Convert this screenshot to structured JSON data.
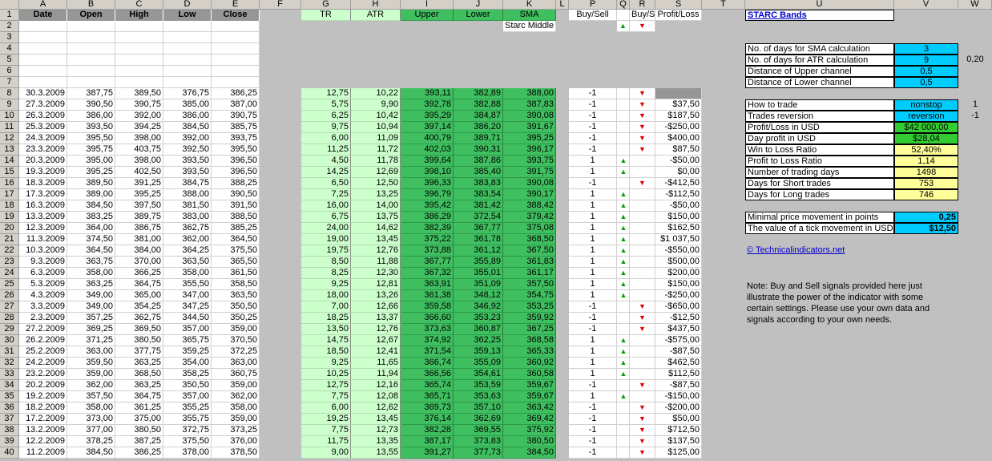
{
  "columns": [
    "A",
    "B",
    "C",
    "D",
    "E",
    "F",
    "G",
    "H",
    "I",
    "J",
    "K",
    "L",
    "P",
    "Q",
    "R",
    "S",
    "T",
    "U",
    "V",
    "W"
  ],
  "headers": {
    "date": "Date",
    "open": "Open",
    "high": "High",
    "low": "Low",
    "close": "Close",
    "tr": "TR",
    "atr": "ATR",
    "upper": "Upper",
    "lower": "Lower",
    "sma": "SMA",
    "starc_middle": "Starc Middle",
    "buysell1": "Buy/Sell",
    "buysell2": "Buy/Sell",
    "profitloss": "Profit/Loss"
  },
  "title_link": "STARC Bands",
  "params": [
    {
      "label": "No. of days for SMA calculation",
      "value": "3"
    },
    {
      "label": "No. of days for ATR calculation",
      "value": "9"
    },
    {
      "label": "Distance of Upper channel",
      "value": "0,5"
    },
    {
      "label": "Distance of Lower channel",
      "value": "0,5"
    }
  ],
  "param_side": "0,20",
  "trade": [
    {
      "label": "How to trade",
      "value": "nonstop",
      "color": "#00ccff"
    },
    {
      "label": "Trades reversion",
      "value": "reversion",
      "color": "#00ccff"
    },
    {
      "label": "Profit/Loss in USD",
      "value": "$42 000,00",
      "color": "#33cc33"
    },
    {
      "label": "Day profit in USD",
      "value": "$28,04",
      "color": "#33cc33"
    },
    {
      "label": "Win to Loss Ratio",
      "value": "52,40%",
      "color": "#ffff99"
    },
    {
      "label": "Profit to Loss Ratio",
      "value": "1,14",
      "color": "#ffff99"
    },
    {
      "label": "Number of trading days",
      "value": "1498",
      "color": "#ffff99"
    },
    {
      "label": "Days for Short trades",
      "value": "753",
      "color": "#ffff99"
    },
    {
      "label": "Days for Long trades",
      "value": "746",
      "color": "#ffff99"
    }
  ],
  "trade_side": [
    "1",
    "-1"
  ],
  "tick": [
    {
      "label": "Minimal price movement in points",
      "value": "0,25"
    },
    {
      "label": "The value of a tick movement in USD",
      "value": "$12,50"
    }
  ],
  "website": "© Technicalindicators.net",
  "note": "Note: Buy and Sell signals provided here just illustrate the power of the indicator with some certain settings. Please use your own data and signals according to your own needs.",
  "rows": [
    [
      "30.3.2009",
      "387,75",
      "389,50",
      "376,75",
      "386,25",
      "12,75",
      "10,22",
      "393,11",
      "382,89",
      "388,00",
      "-1",
      "",
      ""
    ],
    [
      "27.3.2009",
      "390,50",
      "390,75",
      "385,00",
      "387,00",
      "5,75",
      "9,90",
      "392,78",
      "382,88",
      "387,83",
      "-1",
      "",
      "$37,50"
    ],
    [
      "26.3.2009",
      "386,00",
      "392,00",
      "386,00",
      "390,75",
      "6,25",
      "10,42",
      "395,29",
      "384,87",
      "390,08",
      "-1",
      "",
      "$187,50"
    ],
    [
      "25.3.2009",
      "393,50",
      "394,25",
      "384,50",
      "385,75",
      "9,75",
      "10,94",
      "397,14",
      "386,20",
      "391,67",
      "-1",
      "",
      "-$250,00"
    ],
    [
      "24.3.2009",
      "395,50",
      "398,00",
      "392,00",
      "393,75",
      "6,00",
      "11,09",
      "400,79",
      "389,71",
      "395,25",
      "-1",
      "",
      "$400,00"
    ],
    [
      "23.3.2009",
      "395,75",
      "403,75",
      "392,50",
      "395,50",
      "11,25",
      "11,72",
      "402,03",
      "390,31",
      "396,17",
      "-1",
      "",
      "$87,50"
    ],
    [
      "20.3.2009",
      "395,00",
      "398,00",
      "393,50",
      "396,50",
      "4,50",
      "11,78",
      "399,64",
      "387,86",
      "393,75",
      "1",
      "",
      "-$50,00"
    ],
    [
      "19.3.2009",
      "395,25",
      "402,50",
      "393,50",
      "396,50",
      "14,25",
      "12,69",
      "398,10",
      "385,40",
      "391,75",
      "1",
      "",
      "$0,00"
    ],
    [
      "18.3.2009",
      "389,50",
      "391,25",
      "384,75",
      "388,25",
      "6,50",
      "12,50",
      "396,33",
      "383,83",
      "390,08",
      "-1",
      "",
      "-$412,50"
    ],
    [
      "17.3.2009",
      "389,00",
      "395,25",
      "388,00",
      "390,50",
      "7,25",
      "13,25",
      "396,79",
      "383,54",
      "390,17",
      "1",
      "",
      "-$112,50"
    ],
    [
      "16.3.2009",
      "384,50",
      "397,50",
      "381,50",
      "391,50",
      "16,00",
      "14,00",
      "395,42",
      "381,42",
      "388,42",
      "1",
      "",
      "-$50,00"
    ],
    [
      "13.3.2009",
      "383,25",
      "389,75",
      "383,00",
      "388,50",
      "6,75",
      "13,75",
      "386,29",
      "372,54",
      "379,42",
      "1",
      "",
      "$150,00"
    ],
    [
      "12.3.2009",
      "364,00",
      "386,75",
      "362,75",
      "385,25",
      "24,00",
      "14,62",
      "382,39",
      "367,77",
      "375,08",
      "1",
      "",
      "$162,50"
    ],
    [
      "11.3.2009",
      "374,50",
      "381,00",
      "362,00",
      "364,50",
      "19,00",
      "13,45",
      "375,22",
      "361,78",
      "368,50",
      "1",
      "",
      "$1 037,50"
    ],
    [
      "10.3.2009",
      "364,50",
      "384,00",
      "364,25",
      "375,50",
      "19,75",
      "12,76",
      "373,88",
      "361,12",
      "367,50",
      "1",
      "",
      "-$550,00"
    ],
    [
      "9.3.2009",
      "363,75",
      "370,00",
      "363,50",
      "365,50",
      "8,50",
      "11,88",
      "367,77",
      "355,89",
      "361,83",
      "1",
      "",
      "$500,00"
    ],
    [
      "6.3.2009",
      "358,00",
      "366,25",
      "358,00",
      "361,50",
      "8,25",
      "12,30",
      "367,32",
      "355,01",
      "361,17",
      "1",
      "",
      "$200,00"
    ],
    [
      "5.3.2009",
      "363,25",
      "364,75",
      "355,50",
      "358,50",
      "9,25",
      "12,81",
      "363,91",
      "351,09",
      "357,50",
      "1",
      "",
      "$150,00"
    ],
    [
      "4.3.2009",
      "349,00",
      "365,00",
      "347,00",
      "363,50",
      "18,00",
      "13,26",
      "361,38",
      "348,12",
      "354,75",
      "1",
      "",
      "-$250,00"
    ],
    [
      "3.3.2009",
      "349,00",
      "354,25",
      "347,25",
      "350,50",
      "7,00",
      "12,66",
      "359,58",
      "346,92",
      "353,25",
      "-1",
      "",
      "-$650,00"
    ],
    [
      "2.3.2009",
      "357,25",
      "362,75",
      "344,50",
      "350,25",
      "18,25",
      "13,37",
      "366,60",
      "353,23",
      "359,92",
      "-1",
      "",
      "-$12,50"
    ],
    [
      "27.2.2009",
      "369,25",
      "369,50",
      "357,00",
      "359,00",
      "13,50",
      "12,76",
      "373,63",
      "360,87",
      "367,25",
      "-1",
      "",
      "$437,50"
    ],
    [
      "26.2.2009",
      "371,25",
      "380,50",
      "365,75",
      "370,50",
      "14,75",
      "12,67",
      "374,92",
      "362,25",
      "368,58",
      "1",
      "",
      "-$575,00"
    ],
    [
      "25.2.2009",
      "363,00",
      "377,75",
      "359,25",
      "372,25",
      "18,50",
      "12,41",
      "371,54",
      "359,13",
      "365,33",
      "1",
      "",
      "-$87,50"
    ],
    [
      "24.2.2009",
      "359,50",
      "363,25",
      "354,00",
      "363,00",
      "9,25",
      "11,65",
      "366,74",
      "355,09",
      "360,92",
      "1",
      "",
      "$462,50"
    ],
    [
      "23.2.2009",
      "359,00",
      "368,50",
      "358,25",
      "360,75",
      "10,25",
      "11,94",
      "366,56",
      "354,61",
      "360,58",
      "1",
      "",
      "$112,50"
    ],
    [
      "20.2.2009",
      "362,00",
      "363,25",
      "350,50",
      "359,00",
      "12,75",
      "12,16",
      "365,74",
      "353,59",
      "359,67",
      "-1",
      "",
      "-$87,50"
    ],
    [
      "19.2.2009",
      "357,50",
      "364,75",
      "357,00",
      "362,00",
      "7,75",
      "12,08",
      "365,71",
      "353,63",
      "359,67",
      "1",
      "",
      "-$150,00"
    ],
    [
      "18.2.2009",
      "358,00",
      "361,25",
      "355,25",
      "358,00",
      "6,00",
      "12,62",
      "369,73",
      "357,10",
      "363,42",
      "-1",
      "",
      "-$200,00"
    ],
    [
      "17.2.2009",
      "373,00",
      "375,00",
      "355,75",
      "359,00",
      "19,25",
      "13,45",
      "376,14",
      "362,69",
      "369,42",
      "-1",
      "",
      "$50,00"
    ],
    [
      "13.2.2009",
      "377,00",
      "380,50",
      "372,75",
      "373,25",
      "7,75",
      "12,73",
      "382,28",
      "369,55",
      "375,92",
      "-1",
      "",
      "$712,50"
    ],
    [
      "12.2.2009",
      "378,25",
      "387,25",
      "375,50",
      "376,00",
      "11,75",
      "13,35",
      "387,17",
      "373,83",
      "380,50",
      "-1",
      "",
      "$137,50"
    ],
    [
      "11.2.2009",
      "384,50",
      "386,25",
      "378,00",
      "378,50",
      "9,00",
      "13,55",
      "391,27",
      "377,73",
      "384,50",
      "-1",
      "",
      "$125,00"
    ]
  ]
}
